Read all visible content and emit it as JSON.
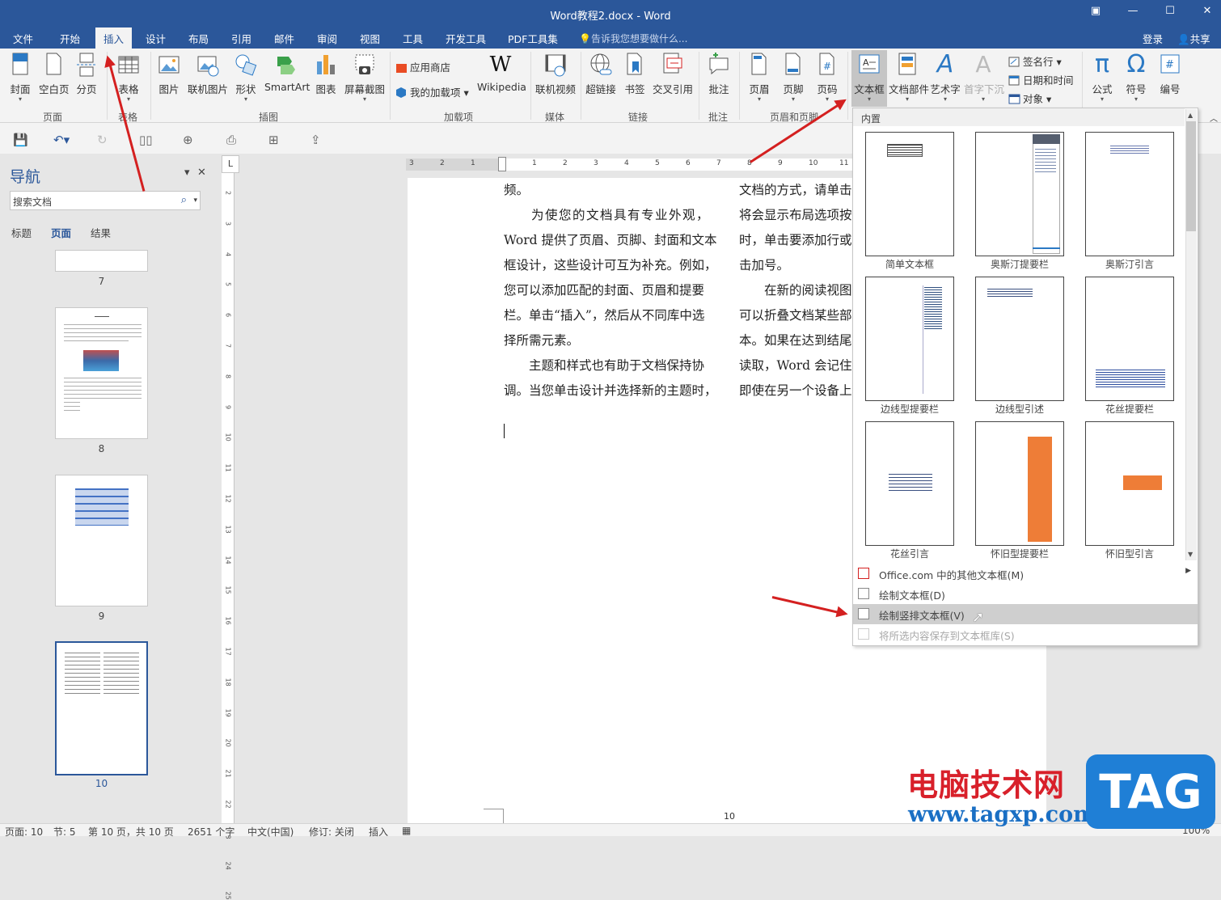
{
  "window": {
    "title": "Word教程2.docx - Word",
    "controls": [
      "▣",
      "—",
      "☐",
      "✕"
    ]
  },
  "menu": {
    "tabs": [
      "文件",
      "开始",
      "插入",
      "设计",
      "布局",
      "引用",
      "邮件",
      "审阅",
      "视图",
      "工具",
      "开发工具",
      "PDF工具集"
    ],
    "active": "插入",
    "tellme": "告诉我您想要做什么...",
    "login": "登录",
    "share": "共享"
  },
  "ribbon": {
    "pages": {
      "cover": "封面",
      "blank": "空白页",
      "break": "分页",
      "group": "页面"
    },
    "tables": {
      "table": "表格",
      "group": "表格"
    },
    "illustrations": {
      "picture": "图片",
      "online_picture": "联机图片",
      "shapes": "形状",
      "smartart": "SmartArt",
      "chart": "图表",
      "screenshot": "屏幕截图",
      "group": "插图"
    },
    "addins": {
      "store": "应用商店",
      "my_addins": "我的加载项",
      "wikipedia": "Wikipedia",
      "group": "加载项"
    },
    "media": {
      "online_video": "联机视频",
      "group": "媒体"
    },
    "links": {
      "hyperlink": "超链接",
      "bookmark": "书签",
      "crossref": "交叉引用",
      "group": "链接"
    },
    "comments": {
      "comment": "批注",
      "group": "批注"
    },
    "header_footer": {
      "header": "页眉",
      "footer": "页脚",
      "page_number": "页码",
      "group": "页眉和页脚"
    },
    "text": {
      "textbox": "文本框",
      "quickparts": "文档部件",
      "wordart": "艺术字",
      "dropcap": "首字下沉",
      "signature": "签名行",
      "datetime": "日期和时间",
      "object": "对象"
    },
    "symbols": {
      "equation": "公式",
      "symbol": "符号",
      "number": "编号"
    }
  },
  "nav": {
    "title": "导航",
    "search_placeholder": "搜索文档",
    "tabs": [
      "标题",
      "页面",
      "结果"
    ],
    "active_tab": "页面",
    "pages": [
      "7",
      "8",
      "9",
      "10"
    ],
    "current_page": "10"
  },
  "ruler": {
    "corner": "L",
    "h_numbers": [
      "3",
      "2",
      "1",
      "1",
      "2",
      "3",
      "4",
      "5",
      "6",
      "7",
      "8",
      "9",
      "10",
      "11"
    ],
    "v_numbers": [
      "2",
      "3",
      "4",
      "5",
      "6",
      "7",
      "8",
      "9",
      "10",
      "11",
      "12",
      "13",
      "14",
      "15",
      "16",
      "17",
      "18",
      "19",
      "20",
      "21",
      "22",
      "23",
      "24",
      "25"
    ]
  },
  "document": {
    "left_column": [
      "频。",
      "　　为使您的文档具有专业外观，",
      "Word 提供了页眉、页脚、封面和文本",
      "框设计，这些设计可互为补充。例如，",
      "您可以添加匹配的封面、页眉和提要",
      "栏。单击“插入”，然后从不同库中选",
      "择所需元素。",
      "　　主题和样式也有助于文档保持协",
      "调。当您单击设计并选择新的主题时，"
    ],
    "right_column": [
      "文档的方式，请单击",
      "将会显示布局选项按",
      "时，单击要添加行或",
      "击加号。",
      "　　在新的阅读视图",
      "可以折叠文档某些部",
      "本。如果在达到结尾",
      "读取，Word 会记住",
      "即使在另一个设备上"
    ],
    "page_footer": "10"
  },
  "textbox_dropdown": {
    "section": "内置",
    "items": [
      "简单文本框",
      "奥斯汀提要栏",
      "奥斯汀引言",
      "边线型提要栏",
      "边线型引述",
      "花丝提要栏",
      "花丝引言",
      "怀旧型提要栏",
      "怀旧型引言"
    ],
    "menu": [
      {
        "label": "Office.com 中的其他文本框(M)",
        "state": "normal",
        "submenu": true
      },
      {
        "label": "绘制文本框(D)",
        "state": "normal"
      },
      {
        "label": "绘制竖排文本框(V)",
        "state": "highlighted"
      },
      {
        "label": "将所选内容保存到文本框库(S)",
        "state": "disabled"
      }
    ]
  },
  "statusbar": {
    "page": "页面: 10",
    "section": "节: 5",
    "pages": "第 10 页，共 10 页",
    "words": "2651 个字",
    "language": "中文(中国)",
    "track": "修订: 关闭",
    "mode": "插入",
    "zoom": "100%"
  },
  "watermark": {
    "site_name": "电脑技术网",
    "url": "www.tagxp.com",
    "tag": "TAG"
  },
  "colors": {
    "brand": "#2b579a",
    "arrow": "#d42020",
    "watermark_red": "#d8202a",
    "watermark_blue": "#1f7fd6"
  }
}
